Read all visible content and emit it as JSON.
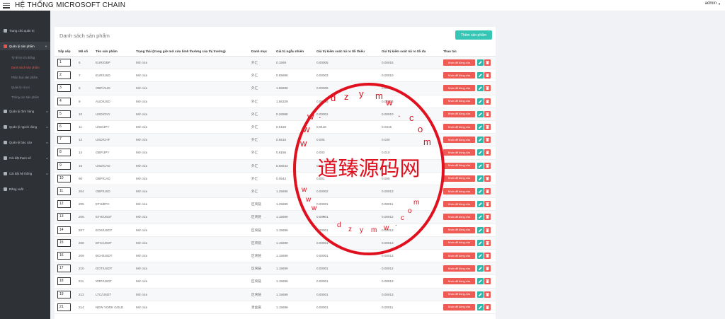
{
  "app": {
    "title": "HỆ THỐNG MICROSOFT CHAIN",
    "user": "admin"
  },
  "sidebar": {
    "items": [
      {
        "label": "Trang chủ quản trị",
        "icon": "dashboard-icon"
      },
      {
        "label": "Quản lý sản phẩm",
        "icon": "product-icon"
      },
      {
        "label": "Quản lý đơn hàng",
        "icon": "orders-icon"
      },
      {
        "label": "Quản lý người dùng",
        "icon": "users-icon"
      },
      {
        "label": "Quản lý báo cáo",
        "icon": "reports-icon"
      },
      {
        "label": "Cài đặt tham số",
        "icon": "params-icon"
      },
      {
        "label": "Cài đặt hệ thống",
        "icon": "system-icon"
      },
      {
        "label": "Đăng xuất",
        "icon": "logout-icon"
      }
    ],
    "sub_items": [
      {
        "label": "Tỷ lệ lợi ích thống"
      },
      {
        "label": "Danh sách sản phẩm"
      },
      {
        "label": "Phân loại sản phẩm"
      },
      {
        "label": "Quản lý cá cơ"
      },
      {
        "label": "Thông các sản phẩm"
      }
    ]
  },
  "page": {
    "title": "Danh sách sản phẩm",
    "add_button": "Thêm sản phẩm"
  },
  "table": {
    "headers": [
      "Sắp xếp",
      "Mã số",
      "Tên sản phẩm",
      "Trạng thái (trong giờ mở cửa bình thường của thị trường)",
      "Danh mục",
      "Giá trị ngẫu nhiên",
      "Giá trị kiểm soát rủi ro tối thiểu",
      "Giá trị kiểm soát rủi ro tối đa",
      "Thao tác"
    ],
    "action_label": "Nhấn để đóng cửa",
    "rows": [
      {
        "order": "1",
        "id": "6",
        "name": "EUR/GBP",
        "status": "Mở cửa",
        "category": "外汇",
        "random": "0.1569",
        "min": "0.00005",
        "max": "0.00015"
      },
      {
        "order": "2",
        "id": "7",
        "name": "EUR/USD",
        "status": "Mở cửa",
        "category": "外汇",
        "random": "0.65695",
        "min": "0.00003",
        "max": "0.00010"
      },
      {
        "order": "3",
        "id": "8",
        "name": "GBP/AUD",
        "status": "Mở cửa",
        "category": "外汇",
        "random": "1.65699",
        "min": "0.00005",
        "max": "0.00015"
      },
      {
        "order": "4",
        "id": "9",
        "name": "AUD/USD",
        "status": "Mở cửa",
        "category": "外汇",
        "random": "1.56329",
        "min": "0.00005",
        "max": "0.00015"
      },
      {
        "order": "5",
        "id": "10",
        "name": "USD/CNY",
        "status": "Mở cửa",
        "category": "外汇",
        "random": "0.26986",
        "min": "0.00001",
        "max": "0.00010"
      },
      {
        "order": "6",
        "id": "11",
        "name": "USD/JPY",
        "status": "Mở cửa",
        "category": "外汇",
        "random": "0.5159",
        "min": "0.0118",
        "max": "0.0315"
      },
      {
        "order": "7",
        "id": "12",
        "name": "USD/CHF",
        "status": "Mở cửa",
        "category": "外汇",
        "random": "0.6516",
        "min": "0.005",
        "max": "0.030"
      },
      {
        "order": "8",
        "id": "14",
        "name": "GBP/JPY",
        "status": "Mở cửa",
        "category": "外汇",
        "random": "0.6156",
        "min": "0.003",
        "max": "0.010"
      },
      {
        "order": "9",
        "id": "16",
        "name": "USD/CAD",
        "status": "Mở cửa",
        "category": "外汇",
        "random": "0.56543",
        "min": "0.001",
        "max": "0.005"
      },
      {
        "order": "10",
        "id": "90",
        "name": "GBP/CAD",
        "status": "Mở cửa",
        "category": "外汇",
        "random": "0.0543",
        "min": "0.001",
        "max": "0.005"
      },
      {
        "order": "11",
        "id": "204",
        "name": "GBP/USD",
        "status": "Mở cửa",
        "category": "外汇",
        "random": "1.25695",
        "min": "0.00002",
        "max": "0.00013"
      },
      {
        "order": "12",
        "id": "205",
        "name": "ETH/BTC",
        "status": "Mở cửa",
        "category": "区块链",
        "random": "1.25699",
        "min": "0.00001",
        "max": "0.00011"
      },
      {
        "order": "13",
        "id": "206",
        "name": "ETH/USDT",
        "status": "Mở cửa",
        "category": "区块链",
        "random": "1.15699",
        "min": "0.00001",
        "max": "0.00012"
      },
      {
        "order": "14",
        "id": "207",
        "name": "EOS/USDT",
        "status": "Mở cửa",
        "category": "区块链",
        "random": "1.15699",
        "min": "0.00001",
        "max": "0.00013"
      },
      {
        "order": "15",
        "id": "208",
        "name": "BTC/USDT",
        "status": "Mở cửa",
        "category": "区块链",
        "random": "1.15699",
        "min": "0.00001",
        "max": "0.00013"
      },
      {
        "order": "16",
        "id": "209",
        "name": "BCH/USDT",
        "status": "Mở cửa",
        "category": "区块链",
        "random": "1.15699",
        "min": "0.00001",
        "max": "0.00013"
      },
      {
        "order": "17",
        "id": "210",
        "name": "DOT/USDT",
        "status": "Mở cửa",
        "category": "区块链",
        "random": "1.15699",
        "min": "0.00001",
        "max": "0.00012"
      },
      {
        "order": "18",
        "id": "211",
        "name": "XRP/USDT",
        "status": "Mở cửa",
        "category": "区块链",
        "random": "1.15699",
        "min": "0.00001",
        "max": "0.00013"
      },
      {
        "order": "19",
        "id": "212",
        "name": "LTC/USDT",
        "status": "Mở cửa",
        "category": "区块链",
        "random": "1.15699",
        "min": "0.00001",
        "max": "0.00013"
      },
      {
        "order": "21",
        "id": "214",
        "name": "NEW YORK GOLD",
        "status": "Mở cửa",
        "category": "贵金属",
        "random": "1.15699",
        "min": "0.00001",
        "max": "0.00011"
      }
    ]
  },
  "watermark": {
    "center_text": "道臻源码网",
    "ring_text": "www.dzymw.com"
  },
  "colors": {
    "sidebar": "#2e3237",
    "accent_teal": "#36c6b5",
    "danger": "#ee5b55",
    "stamp": "#e0101e"
  }
}
